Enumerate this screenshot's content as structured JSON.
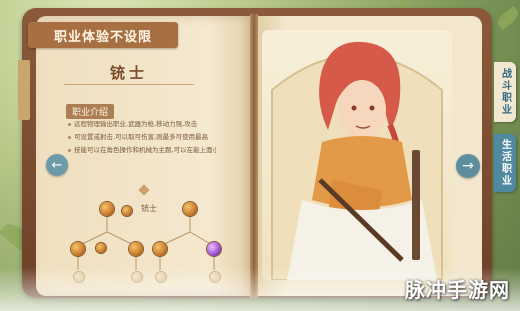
{
  "banner": {
    "title": "职业体验不设限"
  },
  "class_info": {
    "name": "铳士",
    "intro_label": "职业介绍",
    "intro_lines": [
      "远程物理输出职业,武器为枪,移动力强,攻击",
      "可设置或射击,可以取可伤害,则最多可使用最高",
      "技能可以在角色操作和机械为主题,可以在能上面小机器人"
    ],
    "tree_label": "铳士"
  },
  "side_tabs": {
    "battle": "战斗职业",
    "life": "生活职业"
  },
  "nav": {
    "prev": "←",
    "next": "→"
  },
  "watermark": "脉冲手游网",
  "colors": {
    "accent_brown": "#a86f43",
    "accent_blue": "#4f8aa0"
  },
  "character": {
    "hair_color": "pink-red",
    "outfit": "orange scarf with white robe"
  }
}
